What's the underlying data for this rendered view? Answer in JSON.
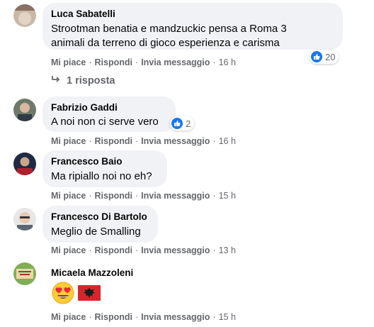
{
  "comments": [
    {
      "author": "Luca Sabatelli",
      "text": "Strootman benatia e mandzuckic pensa a Roma 3\nanimali da terreno di gioco esperienza e carisma",
      "like_label": "Mi piace",
      "reply_label": "Rispondi",
      "message_label": "Invia messaggio",
      "time": "16 h",
      "reactions": "20",
      "replies": "1 risposta"
    },
    {
      "author": "Fabrizio Gaddi",
      "text": "A noi non ci serve vero",
      "like_label": "Mi piace",
      "reply_label": "Rispondi",
      "message_label": "Invia messaggio",
      "time": "16 h",
      "reactions": "2"
    },
    {
      "author": "Francesco Baio",
      "text": "Ma ripiallo noi no eh?",
      "like_label": "Mi piace",
      "reply_label": "Rispondi",
      "message_label": "Invia messaggio",
      "time": "15 h"
    },
    {
      "author": "Francesco Di Bartolo",
      "text": "Meglio de Smalling",
      "like_label": "Mi piace",
      "reply_label": "Rispondi",
      "message_label": "Invia messaggio",
      "time": "13 h"
    },
    {
      "author": "Micaela Mazzoleni",
      "emojis": [
        "heart-eyes-emoji",
        "albania-flag-emoji"
      ],
      "like_label": "Mi piace",
      "reply_label": "Rispondi",
      "message_label": "Invia messaggio",
      "time": "15 h"
    }
  ],
  "separator": "·",
  "colors": {
    "bubble": "#f0f2f5",
    "like_blue": "#1877f2",
    "meta_gray": "#65676b"
  }
}
